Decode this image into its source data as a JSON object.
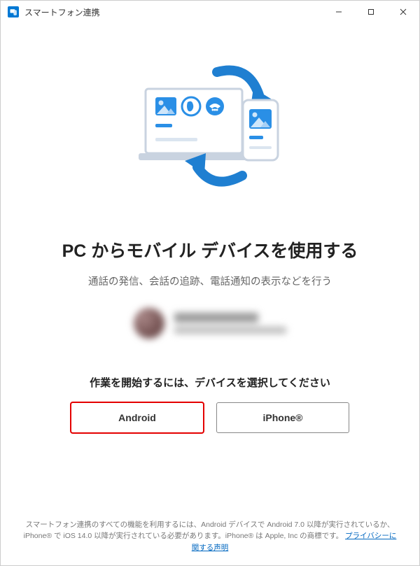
{
  "window": {
    "title": "スマートフォン連携"
  },
  "main": {
    "heading": "PC からモバイル デバイスを使用する",
    "subtitle": "通話の発信、会話の追跡、電話通知の表示などを行う",
    "prompt": "作業を開始するには、デバイスを選択してください"
  },
  "buttons": {
    "android": "Android",
    "iphone": "iPhone®"
  },
  "footer": {
    "text": "スマートフォン連携のすべての機能を利用するには、Android デバイスで Android 7.0 以降が実行されているか、iPhone® で iOS 14.0 以降が実行されている必要があります。iPhone® は Apple, Inc の商標です。",
    "link": "プライバシーに関する声明"
  }
}
